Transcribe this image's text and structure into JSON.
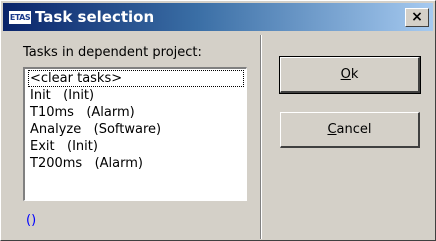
{
  "window": {
    "title": "Task selection",
    "icon_text": "ETAS",
    "close_glyph": "×"
  },
  "tasks_label": "Tasks in dependent project:",
  "tasks": [
    "<clear tasks>",
    "Init   (Init)",
    "T10ms   (Alarm)",
    "Analyze   (Software)",
    "Exit   (Init)",
    "T200ms   (Alarm)"
  ],
  "selection_text": "()",
  "buttons": {
    "ok": {
      "mnemonic": "O",
      "rest": "k"
    },
    "cancel": {
      "mnemonic": "C",
      "rest": "ancel"
    }
  },
  "colors": {
    "title_gradient_start": "#0a246a",
    "title_gradient_end": "#a6caf0",
    "dialog_face": "#d4d0c8",
    "selection_text": "#0000ff"
  }
}
